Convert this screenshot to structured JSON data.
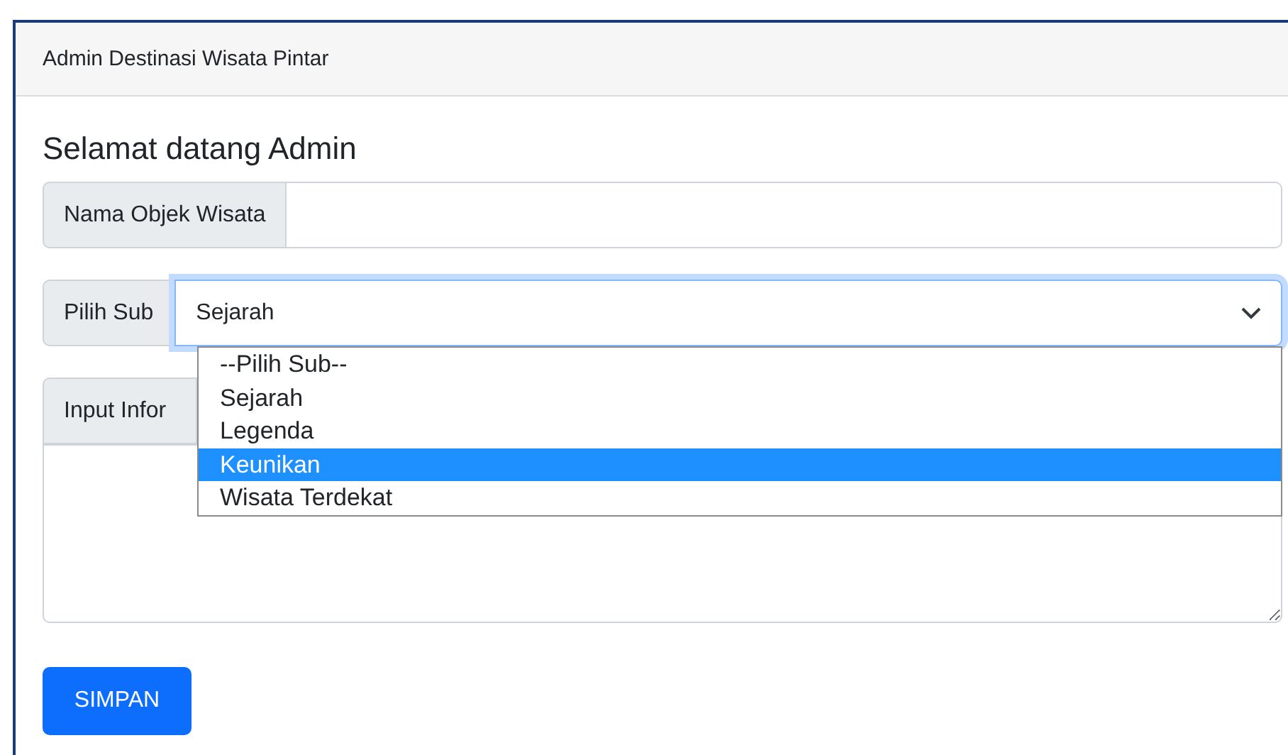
{
  "header": {
    "title": "Admin Destinasi Wisata Pintar"
  },
  "heading": "Selamat datang Admin",
  "fields": [
    {
      "kind": "text",
      "label": "Nama Objek Wisata"
    },
    {
      "kind": "select",
      "label": "Pilih Sub",
      "value": "Sejarah",
      "expanded": true,
      "options": [
        {
          "label": "--Pilih Sub--",
          "highlighted": false
        },
        {
          "label": "Sejarah",
          "highlighted": false
        },
        {
          "label": "Legenda",
          "highlighted": false
        },
        {
          "label": "Keunikan",
          "highlighted": true
        },
        {
          "label": "Wisata Terdekat",
          "highlighted": false
        }
      ]
    },
    {
      "kind": "textarea",
      "label": "Input Infor"
    }
  ],
  "button": "SIMPAN"
}
